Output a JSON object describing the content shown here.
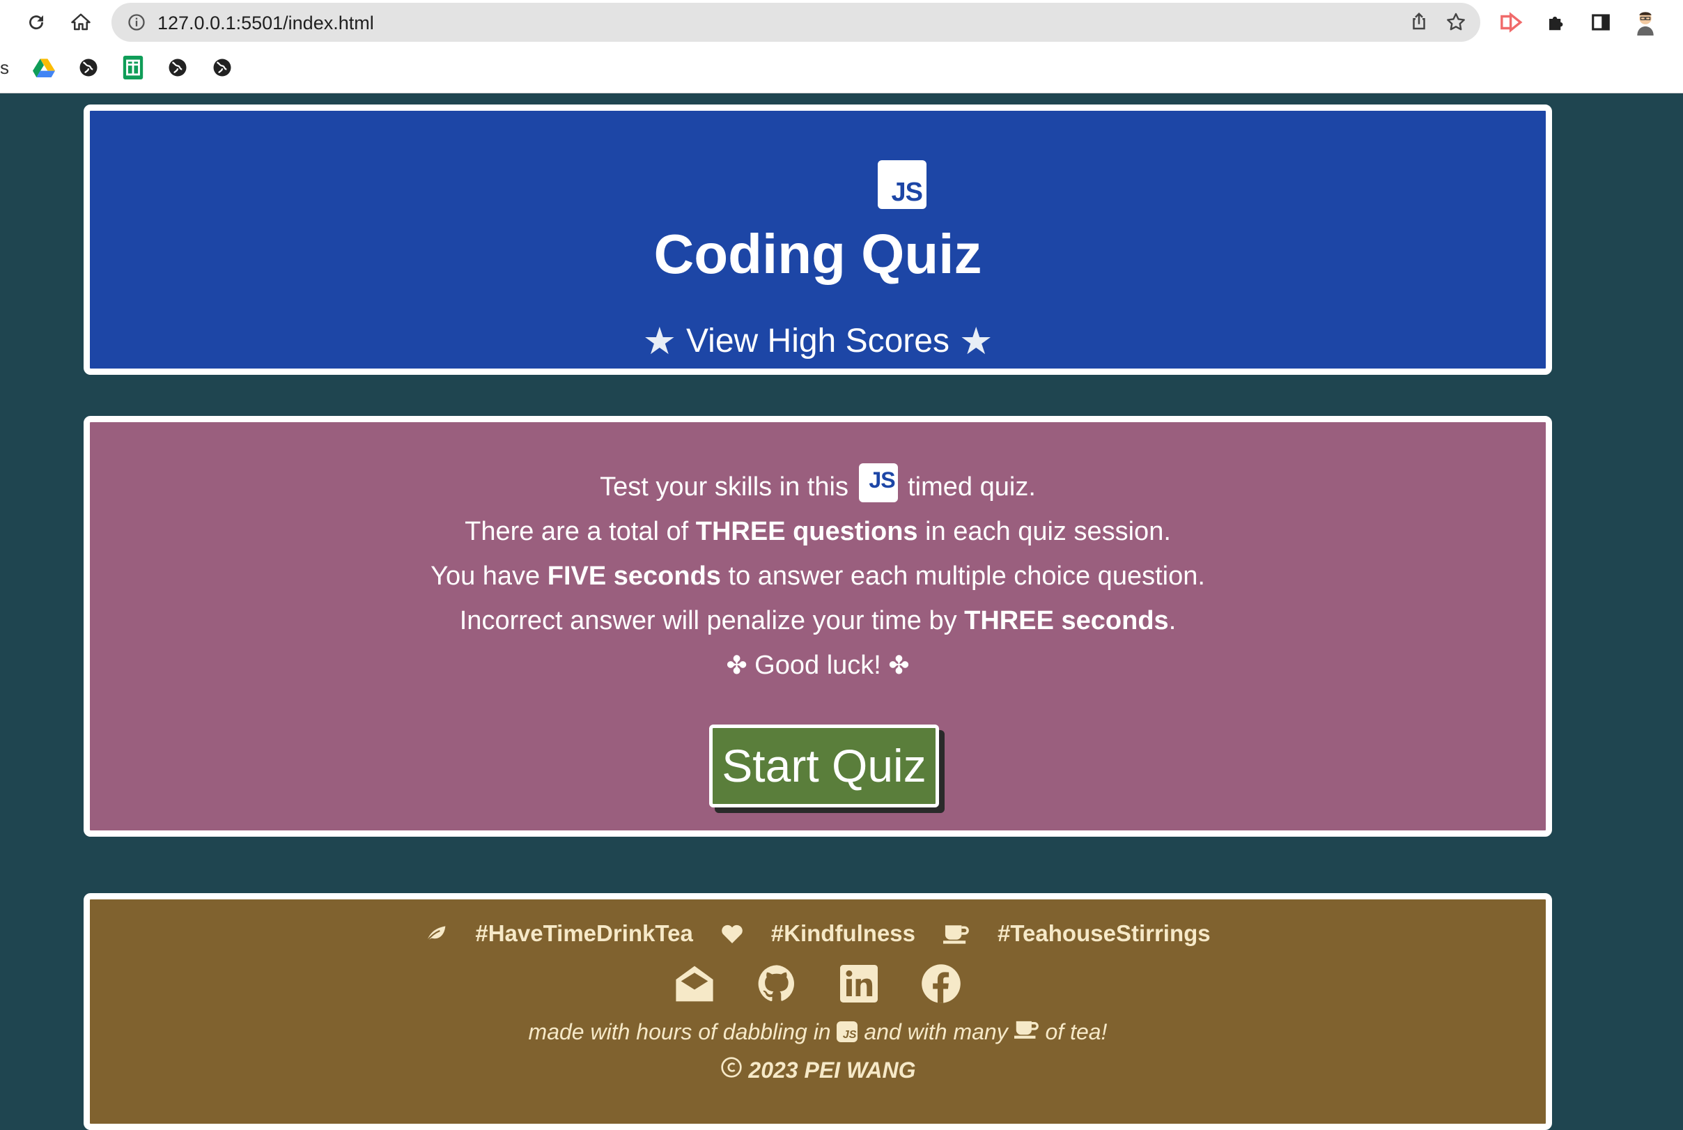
{
  "browser": {
    "url": "127.0.0.1:5501/index.html",
    "bookmark_partial_label": "s"
  },
  "header": {
    "logo_text": "JS",
    "title": "Coding Quiz",
    "high_scores_link": "View High Scores"
  },
  "intro": {
    "line1_pre": "Test your skills in this",
    "line1_logo": "JS",
    "line1_post": "timed quiz.",
    "line2_pre": "There are a total of",
    "line2_bold": "THREE questions",
    "line2_post": "in each quiz session.",
    "line3_pre": "You have",
    "line3_bold": "FIVE seconds",
    "line3_post": "to answer each multiple choice question.",
    "line4_pre": "Incorrect answer will penalize your time by",
    "line4_bold": "THREE seconds",
    "line4_post": ".",
    "good_luck": "Good luck!",
    "start_button": "Start Quiz"
  },
  "footer": {
    "tags": [
      "#HaveTimeDrinkTea",
      "#Kindfulness",
      "#TeahouseStirrings"
    ],
    "tag_icons": [
      "leaf-icon",
      "heart-icon",
      "tea-cup-icon"
    ],
    "social_icons": [
      "email-icon",
      "github-icon",
      "linkedin-icon",
      "facebook-icon"
    ],
    "made_pre": "made with hours of dabbling in",
    "made_logo": "JS",
    "made_mid": "and with many",
    "made_post": "of tea!",
    "copyright": "2023 PEI WANG"
  },
  "colors": {
    "page_bg": "#1f4550",
    "header_bg": "#1d46a6",
    "info_bg": "#9a5f7e",
    "footer_bg": "#80622f",
    "start_button_bg": "#5a7e3b",
    "footer_text": "#f6e9c8"
  }
}
